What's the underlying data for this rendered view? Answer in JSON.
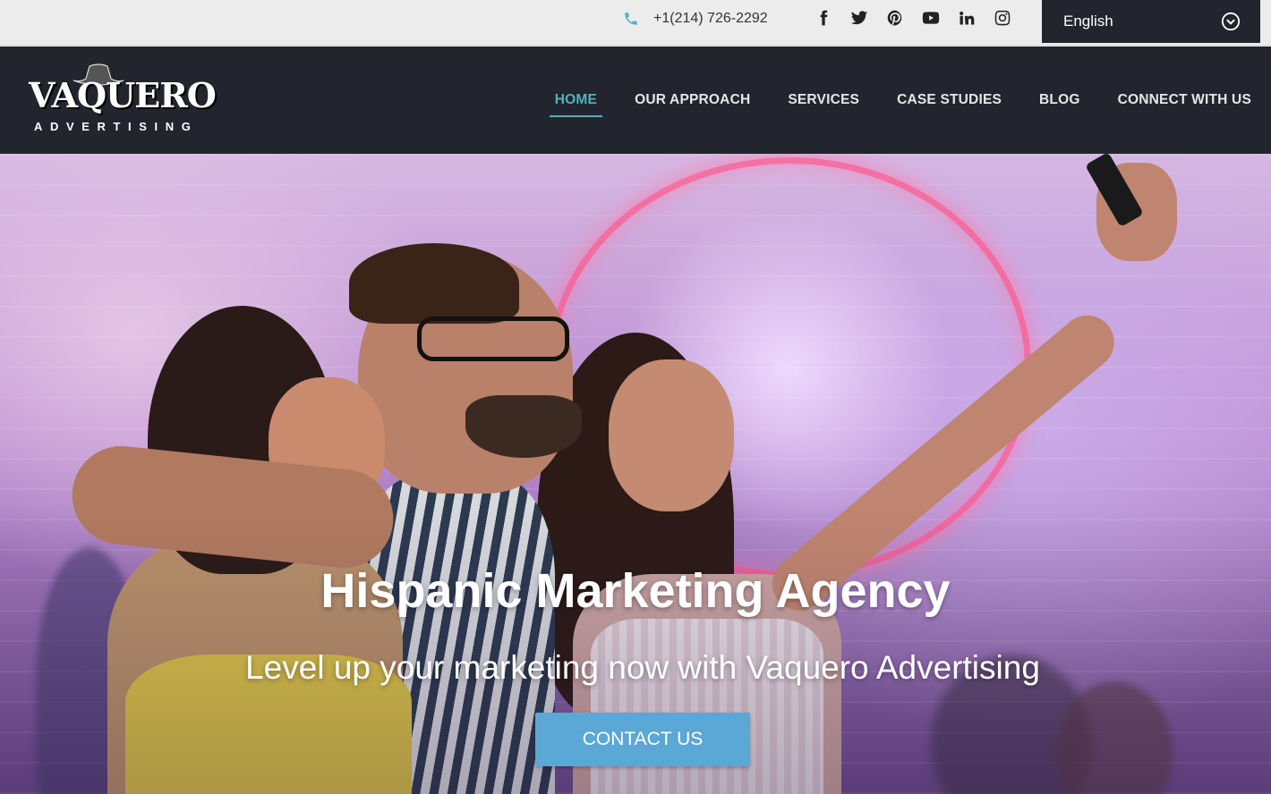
{
  "topbar": {
    "phone": "+1(214) 726-2292",
    "socials": [
      {
        "icon": "facebook-icon"
      },
      {
        "icon": "twitter-icon"
      },
      {
        "icon": "pinterest-icon"
      },
      {
        "icon": "youtube-icon"
      },
      {
        "icon": "linkedin-icon"
      },
      {
        "icon": "instagram-icon"
      }
    ],
    "language": "English"
  },
  "logo": {
    "brand": "VAQUERO",
    "sub": "ADVERTISING"
  },
  "nav": {
    "items": [
      {
        "label": "HOME",
        "active": true
      },
      {
        "label": "OUR APPROACH",
        "active": false
      },
      {
        "label": "SERVICES",
        "active": false
      },
      {
        "label": "CASE STUDIES",
        "active": false
      },
      {
        "label": "BLOG",
        "active": false
      },
      {
        "label": "CONNECT WITH US",
        "active": false
      }
    ]
  },
  "hero": {
    "title": "Hispanic Marketing Agency",
    "subtitle": "Level up your marketing now with Vaquero Advertising",
    "cta_label": "CONTACT US"
  },
  "colors": {
    "accent": "#4fb3bf",
    "navbar_bg": "#22252d",
    "topbar_bg": "#ececec",
    "cta_bg": "#5ba7d6"
  }
}
